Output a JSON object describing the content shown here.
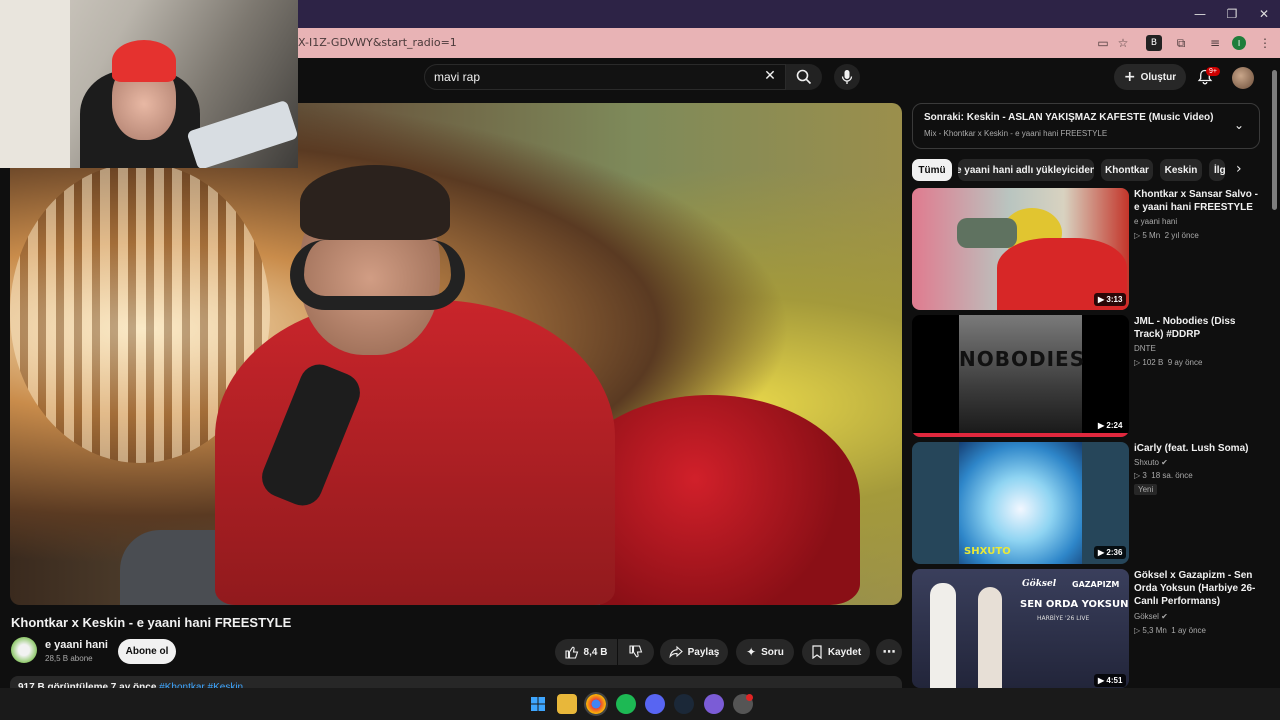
{
  "browser": {
    "url": "X-I1Z-GDVWY&start_radio=1",
    "window_controls": [
      "—",
      "❐",
      "✕"
    ]
  },
  "header": {
    "search_value": "mavi  rap",
    "create_label": "Oluştur",
    "notification_count": "9+"
  },
  "video": {
    "title": "Khontkar x Keskin - e yaani hani FREESTYLE",
    "channel_name": "e yaani hani",
    "subscribers": "28,5 B abone",
    "subscribe_label": "Abone ol",
    "like_count": "8,4 B",
    "share_label": "Paylaş",
    "ask_label": "Soru",
    "save_label": "Kaydet",
    "description_stats": "917 B görüntüleme  7 ay önce",
    "description_tags": "#Khontkar #Keskin"
  },
  "sidebar": {
    "next_up_title": "Sonraki: Keskin - ASLAN YAKIŞMAZ KAFESTE (Music Video)",
    "next_up_subtitle": "Mix - Khontkar x Keskin - e yaani hani FREESTYLE",
    "chips": [
      "Tümü",
      "e yaani hani adlı yükleyiciden",
      "Khontkar",
      "Keskin",
      "İlgili"
    ],
    "recommendations": [
      {
        "title": "Khontkar x Sansar Salvo - e yaani hani FREESTYLE",
        "channel": "e yaani hani",
        "views": "5 Mn",
        "age": "2 yıl önce",
        "duration": "3:13",
        "verified": false,
        "badge": ""
      },
      {
        "title": "JML - Nobodies (Diss Track) #DDRP",
        "channel": "DNTE",
        "views": "102 B",
        "age": "9 ay önce",
        "duration": "2:24",
        "verified": false,
        "badge": ""
      },
      {
        "title": "iCarly (feat. Lush Soma)",
        "channel": "Shxuto",
        "views": "3",
        "age": "18 sa. önce",
        "duration": "2:36",
        "verified": true,
        "badge": "Yeni"
      },
      {
        "title": "Göksel x Gazapizm - Sen Orda Yoksun (Harbiye 26-Canlı Performans)",
        "channel": "Göksel",
        "views": "5,3 Mn",
        "age": "1 ay önce",
        "duration": "4:51",
        "verified": true,
        "badge": ""
      }
    ]
  },
  "thumbnail_texts": {
    "nobodies": "NOBODIES",
    "shxuto": "SHXUTO",
    "goksel_logo": "Göksel",
    "gazapizm_logo": "GAZAPIZM",
    "sen_orda": "SEN ORDA YOKSUN",
    "harbiye": "HARBİYE '26 LIVE"
  },
  "colors": {
    "background": "#0f0f0f",
    "surface": "#272727",
    "accent_red": "#cc0000",
    "link_blue": "#3ea6ff",
    "titlebar": "#2d2346",
    "addressbar": "#e8b3b5"
  }
}
